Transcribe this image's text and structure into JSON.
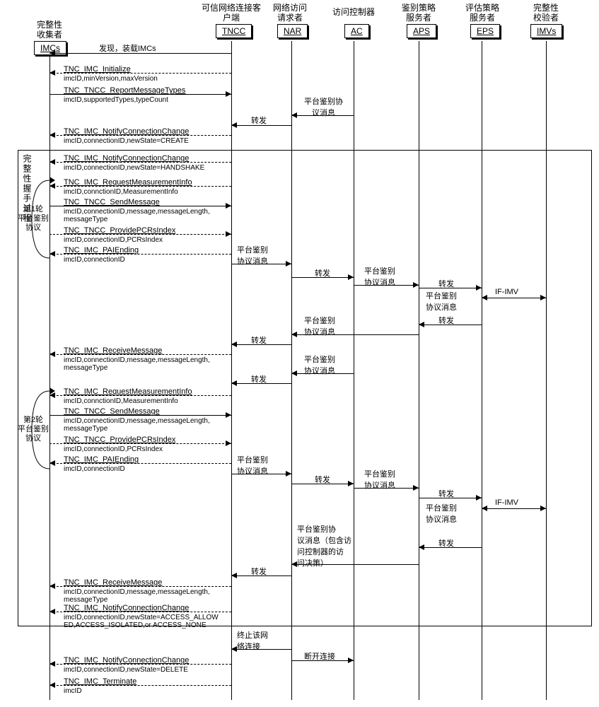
{
  "actors": {
    "imcs": {
      "label": "完整性\n收集者",
      "box": "IMCs"
    },
    "tncc": {
      "label": "可信网络连接客\n户端",
      "box": "TNCC"
    },
    "nar": {
      "label": "网络访问\n请求者",
      "box": "NAR"
    },
    "ac": {
      "label": "访问控制器",
      "box": "AC"
    },
    "aps": {
      "label": "鉴别策略\n服务者",
      "box": "APS"
    },
    "eps": {
      "label": "评估策略\n服务者",
      "box": "EPS"
    },
    "imvs": {
      "label": "完整性\n校验者",
      "box": "IMVs"
    }
  },
  "group_label": "完整性握手过程",
  "round1_label": "第1轮\n平台鉴别\n协议",
  "round2_label": "第2轮\n平台鉴别\n协议",
  "messages": {
    "discover": "发现，装载IMCs",
    "init": {
      "name": "TNC_IMC_Initialize",
      "params": "imcID,minVersion,maxVersion"
    },
    "report": {
      "name": "TNC_TNCC_ReportMessageTypes",
      "params": "imcID,supportedTypes,typeCount"
    },
    "plat_auth_msg": "平台鉴别协\n议消息",
    "forward": "转发",
    "notify_create": {
      "name": "TNC_IMC_NotifyConnectionChange",
      "params": "imcID,connectionID,newState=CREATE"
    },
    "notify_handshake": {
      "name": "TNC_IMC_NotifyConnectionChange",
      "params": "imcID,connectionID,newState=HANDSHAKE"
    },
    "req_measure": {
      "name": "TNC_IMC_RequestMeasurementInfo",
      "params": "imcID,connctionID,MeasurementInfo"
    },
    "send_msg": {
      "name": "TNC_TNCC_SendMessage",
      "params": "imcID,connectionID,message,messageLength,\nmessageType"
    },
    "provide_pcrs": {
      "name": "TNC_TNCC_ProvidePCRsIndex",
      "params": "imcID,connectionID,PCRsIndex"
    },
    "pai_ending": {
      "name": "TNC_IMC_PAIEnding",
      "params": "imcID,connectionID"
    },
    "plat_auth_msg2": "平台鉴别\n协议消息",
    "if_imv": "IF-IMV",
    "recv_msg": {
      "name": "TNC_IMC_ReceiveMessage",
      "params": "imcID,connectionID,message,messageLength,\nmessageType"
    },
    "plat_auth_decision": "平台鉴别协\n议消息（包含访\n问控制器的访\n问决策）",
    "notify_access": {
      "name": "TNC_IMC_NotifyConnectionChange",
      "params": "imcID,connectionID,newState=ACCESS_ALLOW\nED,ACCESS_ISOLATED,or ACCESS_NONE"
    },
    "terminate_conn": "终止该网\n络连接",
    "disconnect": "断开连接",
    "notify_delete": {
      "name": "TNC_IMC_NotifyConnectionChange",
      "params": "imcID,connectionID,newState=DELETE"
    },
    "imc_terminate": {
      "name": "TNC_IMC_Terminate",
      "params": "imcID"
    }
  }
}
